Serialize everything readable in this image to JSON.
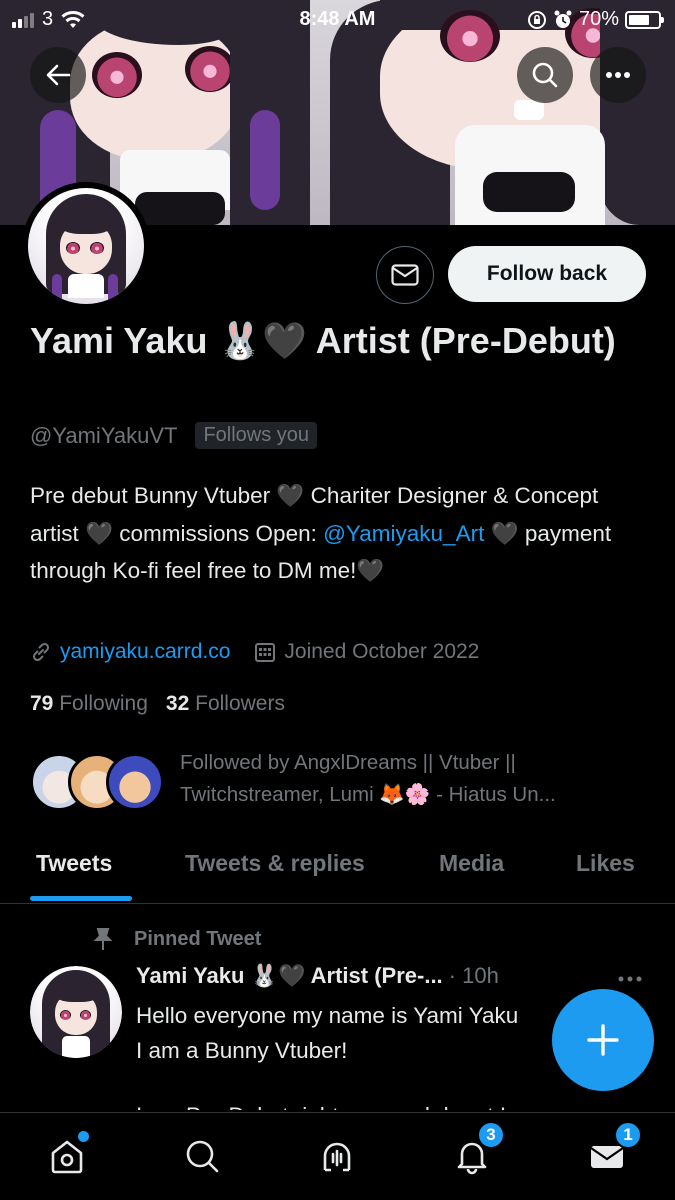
{
  "status_bar": {
    "carrier": "3",
    "time": "8:48 AM",
    "battery": "70%",
    "battery_level": 0.7
  },
  "profile": {
    "display_name": "Yami Yaku 🐰🖤 Artist (Pre-Debut)",
    "handle": "@YamiYakuVT",
    "follows_you": "Follows you",
    "bio_part1": "Pre debut Bunny Vtuber 🖤 Chariter Designer & Concept artist 🖤 commissions Open: ",
    "bio_link": "@Yamiyaku_Art",
    "bio_part2": " 🖤 payment through Ko-fi feel free to DM me!🖤",
    "website": "yamiyaku.carrd.co",
    "joined": "Joined October 2022",
    "following_count": "79",
    "following_label": "Following",
    "followers_count": "32",
    "followers_label": "Followers",
    "followed_by": "Followed by AngxlDreams || Vtuber || Twitchstreamer, Lumi 🦊🌸 - Hiatus Un..."
  },
  "actions": {
    "follow_back": "Follow back"
  },
  "tabs": [
    {
      "label": "Tweets"
    },
    {
      "label": "Tweets & replies"
    },
    {
      "label": "Media"
    },
    {
      "label": "Likes"
    }
  ],
  "pinned_tweet": {
    "pinned_label": "Pinned Tweet",
    "author": "Yami Yaku 🐰🖤 Artist (Pre-...",
    "time": "· 10h",
    "line1": "Hello everyone my name is Yami Yaku",
    "line2": "I am a Bunny Vtuber!",
    "line3": "I am Pre-Debut right now and do art I"
  },
  "bottom_nav": {
    "notifications_badge": "3",
    "messages_badge": "1"
  },
  "colors": {
    "accent": "#1d9bf0",
    "background": "#000000",
    "muted_text": "#71767b"
  }
}
